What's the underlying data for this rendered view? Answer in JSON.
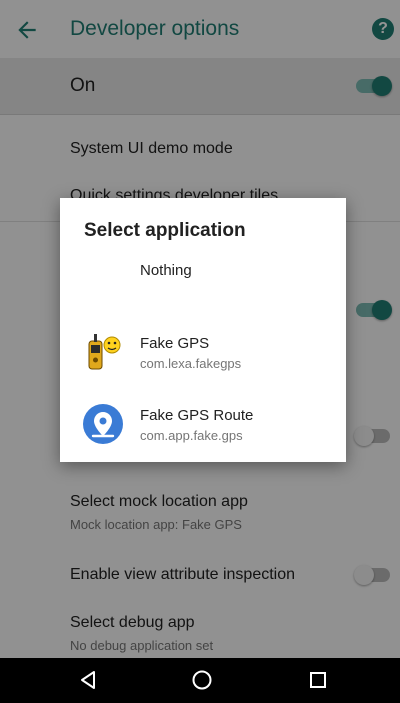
{
  "header": {
    "title": "Developer options"
  },
  "master_toggle": {
    "label": "On",
    "state": "on"
  },
  "settings": [
    {
      "title": "System UI demo mode"
    },
    {
      "title": "Quick settings developer tiles"
    },
    {
      "title": "Select mock location app",
      "subtitle": "Mock location app: Fake GPS"
    },
    {
      "title": "Enable view attribute inspection",
      "toggle": "off"
    },
    {
      "title": "Select debug app",
      "subtitle": "No debug application set"
    }
  ],
  "dialog": {
    "title": "Select application",
    "options": [
      {
        "label": "Nothing"
      },
      {
        "label": "Fake GPS",
        "package": "com.lexa.fakegps",
        "icon": "gps-device-icon"
      },
      {
        "label": "Fake GPS Route",
        "package": "com.app.fake.gps",
        "icon": "location-pin-icon"
      }
    ]
  },
  "colors": {
    "accent": "#1f7c73",
    "route_icon": "#3a7bd5"
  }
}
